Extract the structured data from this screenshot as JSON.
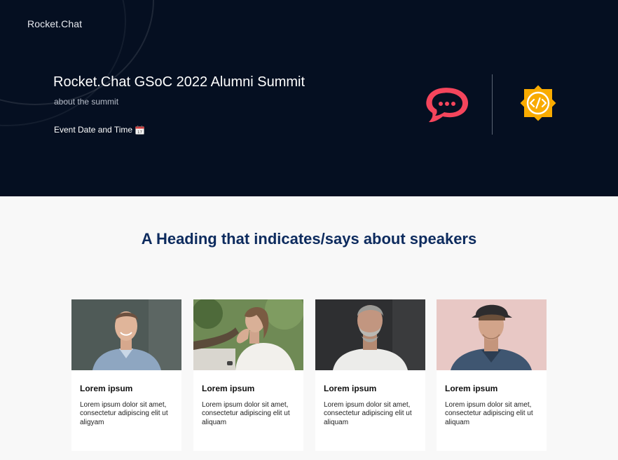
{
  "header": {
    "brand": "Rocket.Chat",
    "title": "Rocket.Chat GSoC 2022 Alumni Summit",
    "subtitle": "about the summit",
    "event_label": "Event Date and Time",
    "event_icon": "calendar-icon"
  },
  "logos": {
    "rocketchat": {
      "icon": "rocketchat-logo-icon",
      "color": "#f5455c"
    },
    "gsoc": {
      "icon": "gsoc-logo-icon",
      "color": "#f9ab00"
    }
  },
  "speakers": {
    "heading": "A Heading that indicates/says about speakers",
    "cards": [
      {
        "name": "Lorem ipsum",
        "desc": "Lorem ipsum dolor sit amet, consectetur adipiscing elit ut aligyam"
      },
      {
        "name": "Lorem ipsum",
        "desc": "Lorem ipsum dolor sit amet, consectetur adipiscing elit ut aliquam"
      },
      {
        "name": "Lorem ipsum",
        "desc": "Lorem ipsum dolor sit amet, consectetur adipiscing elit ut aliquam"
      },
      {
        "name": "Lorem ipsum",
        "desc": "Lorem ipsum dolor sit amet, consectetur adipiscing elit ut aliquam"
      }
    ]
  },
  "colors": {
    "hero_bg": "#050f21",
    "heading": "#0d2b5e",
    "section_bg": "#f8f8f8"
  }
}
